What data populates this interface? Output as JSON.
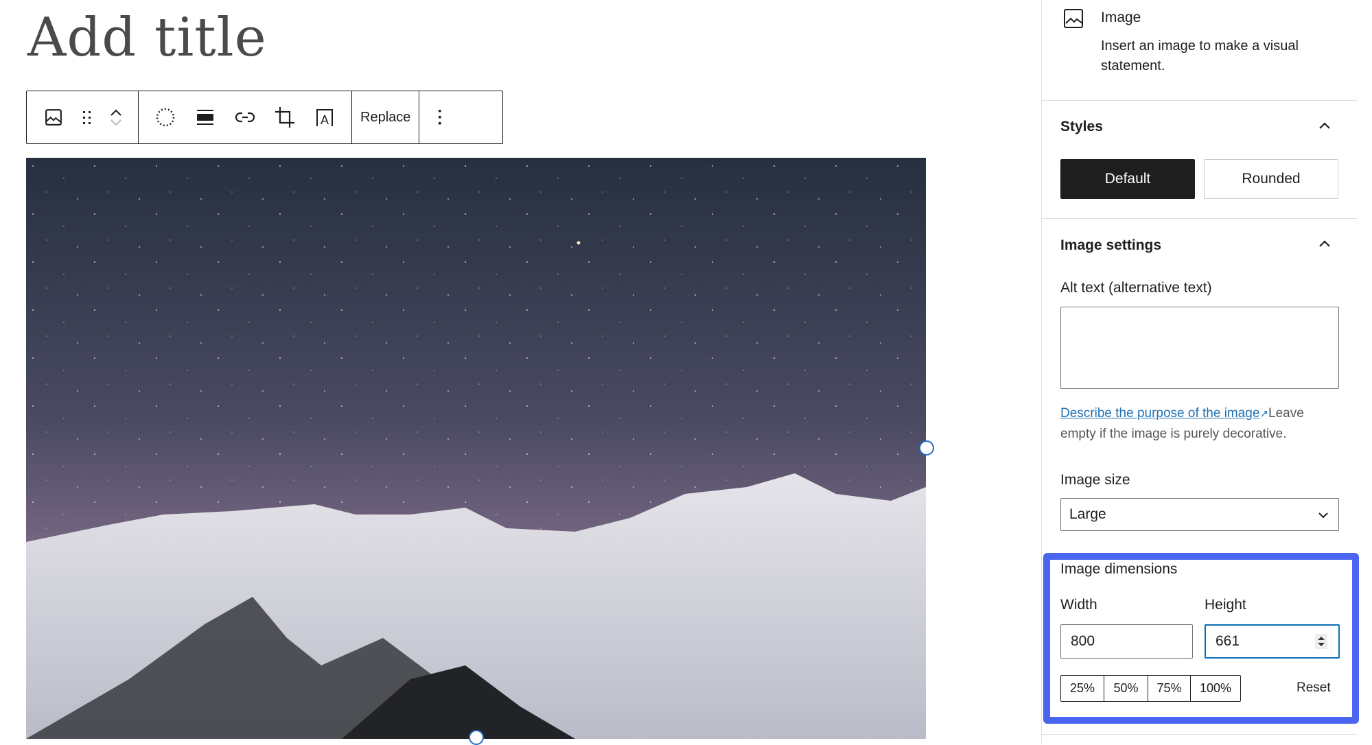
{
  "editor": {
    "title_placeholder": "Add title"
  },
  "toolbar": {
    "replace_label": "Replace",
    "icons": [
      "image-icon",
      "drag-handle-icon",
      "move-up-icon",
      "move-down-icon",
      "duotone-icon",
      "align-icon",
      "link-icon",
      "crop-icon",
      "text-overlay-icon",
      "more-options-icon"
    ]
  },
  "sidebar": {
    "block": {
      "name": "Image",
      "description": "Insert an image to make a visual",
      "description2": "statement."
    },
    "styles": {
      "heading": "Styles",
      "options": [
        "Default",
        "Rounded"
      ],
      "selected": "Default"
    },
    "image_settings": {
      "heading": "Image settings",
      "alt_label": "Alt text (alternative text)",
      "alt_value": "",
      "help_link": "Describe the purpose of the image",
      "help_after": "Leave",
      "help_line2": "empty if the image is purely decorative.",
      "size_label": "Image size",
      "size_value": "Large"
    },
    "dimensions": {
      "heading": "Image dimensions",
      "width_label": "Width",
      "height_label": "Height",
      "width": "800",
      "height": "661",
      "presets": [
        "25%",
        "50%",
        "75%",
        "100%"
      ],
      "reset": "Reset"
    }
  },
  "colors": {
    "highlight": "#4a66f0",
    "focus": "#0a6fb5",
    "link": "#2271b1",
    "primary": "#1e1e1e"
  }
}
